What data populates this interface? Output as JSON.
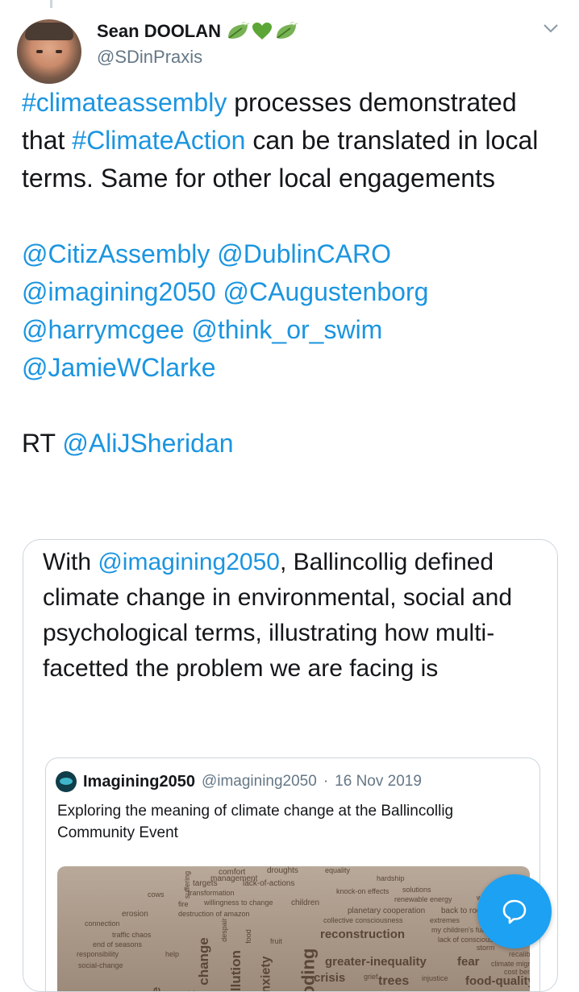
{
  "tweet": {
    "author": {
      "display_name": "Sean DOOLAN",
      "name_emoji": [
        "leaf-icon",
        "green-heart-icon",
        "leaf-icon"
      ],
      "handle": "@SDinPraxis"
    },
    "paragraph1": {
      "tag1": "#climateassembly",
      "t1": " processes demonstrated that ",
      "tag2": "#ClimateAction",
      "t2": " can be translated in local terms. Same for other local engagements"
    },
    "mentions": [
      "@CitizAssembly",
      "@DublinCARO",
      "@imagining2050",
      "@CAugustenborg",
      "@harrymcgee",
      "@think_or_swim",
      "@JamieWClarke"
    ],
    "rt_prefix": "RT ",
    "rt_mention": "@AliJSheridan"
  },
  "quoted": {
    "prefix": "With ",
    "mention": "@imagining2050",
    "rest": ", Ballincollig defined climate change in environmental, social and psychological terms, illustrating how multi-facetted the problem we are facing is",
    "inner": {
      "name": "Imagining2050",
      "handle": "@imagining2050",
      "separator": "·",
      "date": "16 Nov 2019",
      "text": "Exploring the meaning of climate change at the Ballincollig Community Event"
    }
  },
  "wordcloud": [
    "comfort",
    "droughts",
    "equality",
    "management",
    "targets",
    "suffering",
    "lack-of-actions",
    "hardship",
    "cows",
    "transformation",
    "knock-on effects",
    "solutions",
    "fire",
    "willingness to change",
    "children",
    "renewable energy",
    "warming",
    "erosion",
    "destruction of amazon",
    "planetary cooperation",
    "back to roots",
    "conflict",
    "connection",
    "collective consciousness",
    "extremes",
    "traffic chaos",
    "despair",
    "reconstruction",
    "my children's future",
    "end of seasons",
    "fruit",
    "lack of consciousness",
    "responsibility",
    "help",
    "storm",
    "recalibration",
    "climate migration",
    "social-change",
    "greater-inequality",
    "fear",
    "cost benefits",
    "crisis",
    "grief",
    "trees",
    "injustice",
    "food-quality",
    "change",
    "pollution",
    "anxiety",
    "flooding",
    "food",
    "ion",
    "ge",
    "t"
  ],
  "colors": {
    "link": "#1b95e0",
    "fab": "#1da1f2",
    "text": "#14171a",
    "muted": "#657786"
  }
}
